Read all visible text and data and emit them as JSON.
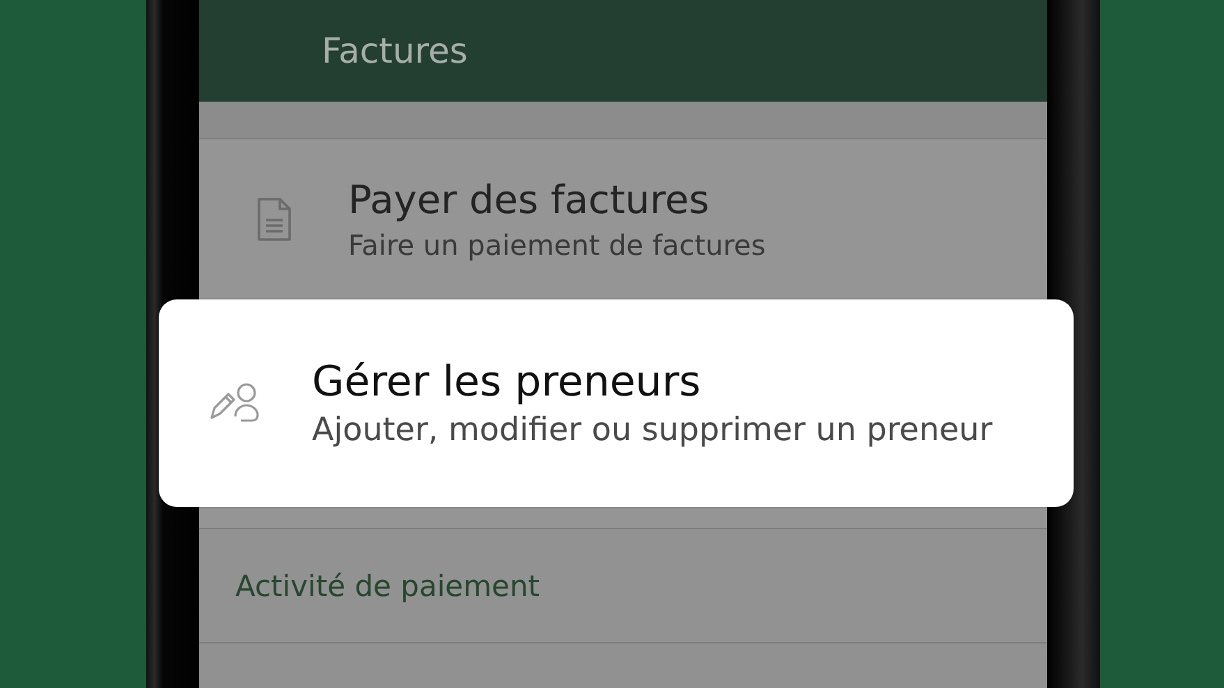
{
  "header": {
    "title": "Factures"
  },
  "items": [
    {
      "title": "Payer des factures",
      "subtitle": "Faire un paiement de factures",
      "highlighted": false,
      "kind": "document"
    },
    {
      "title": "Gérer les preneurs",
      "subtitle": "Ajouter, modifier ou supprimer un preneur",
      "highlighted": true,
      "kind": "payee"
    }
  ],
  "section": {
    "title": "Activité de paiement"
  }
}
